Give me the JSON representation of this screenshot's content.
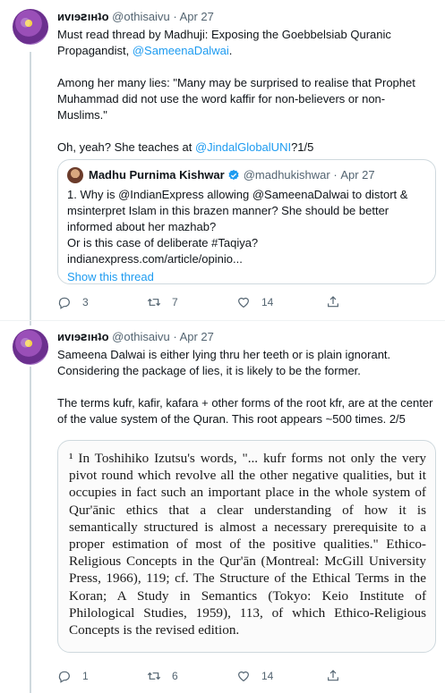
{
  "tweet1": {
    "display_name": "ᴎvıɘꙅıʜʇo",
    "handle": "@othisaivu",
    "separator": "·",
    "date": "Apr 27",
    "line1": "Must read thread by Madhuji: Exposing the Goebbelsiab Quranic Propagandist, ",
    "mention1": "@SameenaDalwai",
    "line1_end": ".",
    "para2": "Among her many lies: \"Many may be surprised to realise that Prophet Muhammad did not use the word kaffir for non-believers or non-Muslims.\"",
    "para3_start": "Oh, yeah? She teaches at ",
    "mention2": "@JindalGlobalUNI",
    "para3_end": "?1/5",
    "quote": {
      "name": "Madhu Purnima Kishwar",
      "handle": "@madhukishwar",
      "separator": "·",
      "date": "Apr 27",
      "body": "1. Why is @IndianExpress allowing @SameenaDalwai to distort & msinterpret Islam in this brazen manner? She should be better informed about her mazhab?\nOr is this case of deliberate #Taqiya?\n indianexpress.com/article/opinio...",
      "show_thread": "Show this thread"
    },
    "replies": "3",
    "retweets": "7",
    "likes": "14"
  },
  "tweet2": {
    "display_name": "ᴎvıɘꙅıʜʇo",
    "handle": "@othisaivu",
    "separator": "·",
    "date": "Apr 27",
    "para1": "Sameena Dalwai is either lying thru her teeth or is plain ignorant. Considering the package of lies, it is likely to be the former.",
    "para2": "The terms kufr, kafir, kafara + other forms of the root kfr, are at the center of the value system of the Quran. This root appears ~500 times. 2/5",
    "image_text": "¹ In Toshihiko Izutsu's words, \"... kufr forms not only the very pivot round which revolve all the other negative qualities, but it occupies in fact such an important place in the whole system of Qur'ānic ethics that a clear understanding of how it is semantically structured is almost a necessary prerequisite to a proper estimation of most of the positive qualities.\" Ethico-Religious Concepts in the Qur'ān (Montreal: McGill University Press, 1966), 119; cf. The Structure of the Ethical Terms in the Koran; A Study in Semantics (Tokyo: Keio Institute of Philological Studies, 1959), 113, of which Ethico-Religious Concepts is the revised edition.",
    "replies": "1",
    "retweets": "6",
    "likes": "14"
  },
  "colors": {
    "link": "#1d9bf0",
    "secondary": "#536471",
    "border": "#cfd9de"
  },
  "icons": [
    "reply-icon",
    "retweet-icon",
    "like-icon",
    "share-icon",
    "verified-icon"
  ]
}
